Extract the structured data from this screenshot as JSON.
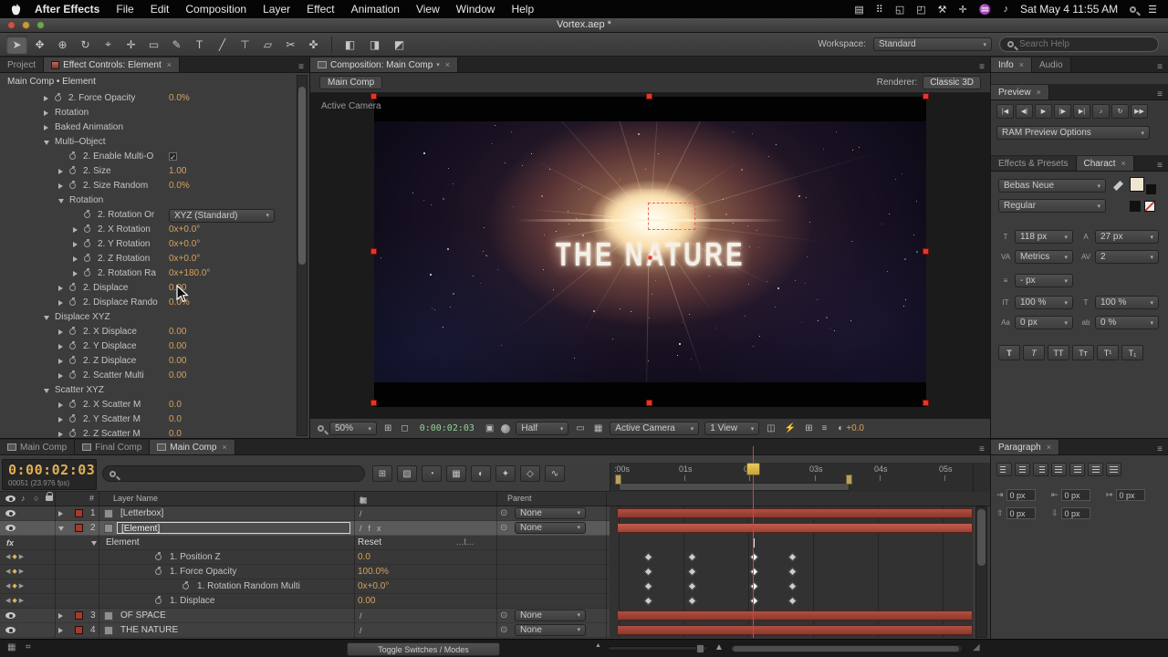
{
  "menubar": {
    "app_name": "After Effects",
    "items": [
      "File",
      "Edit",
      "Composition",
      "Layer",
      "Effect",
      "Animation",
      "View",
      "Window",
      "Help"
    ],
    "status_icons": [
      {
        "name": "display-capture-icon",
        "glyph": "▤"
      },
      {
        "name": "widgets-icon",
        "glyph": "⠿"
      },
      {
        "name": "display-mirror-icon",
        "glyph": "◱"
      },
      {
        "name": "display-icon",
        "glyph": "◰"
      },
      {
        "name": "tool-icon",
        "glyph": "⚒"
      },
      {
        "name": "move-icon",
        "glyph": "✛"
      },
      {
        "name": "wifi-icon",
        "glyph": "♒"
      },
      {
        "name": "volume-icon",
        "glyph": "♪"
      }
    ],
    "clock": "Sat May 4 11:55 AM"
  },
  "window_title": "Vortex.aep *",
  "toolbar": {
    "tools": [
      {
        "name": "selection-tool",
        "glyph": "➤"
      },
      {
        "name": "hand-tool",
        "glyph": "✥"
      },
      {
        "name": "zoom-tool",
        "glyph": "⊕"
      },
      {
        "name": "rotation-tool",
        "glyph": "↻"
      },
      {
        "name": "unified-camera-tool",
        "glyph": "⌖"
      },
      {
        "name": "pan-behind-tool",
        "glyph": "✛"
      },
      {
        "name": "shape-tool",
        "glyph": "▭"
      },
      {
        "name": "pen-tool",
        "glyph": "✎"
      },
      {
        "name": "type-tool",
        "glyph": "T"
      },
      {
        "name": "brush-tool",
        "glyph": "╱"
      },
      {
        "name": "clone-stamp-tool",
        "glyph": "⊤"
      },
      {
        "name": "eraser-tool",
        "glyph": "▱"
      },
      {
        "name": "roto-brush-tool",
        "glyph": "✂"
      },
      {
        "name": "puppet-pin-tool",
        "glyph": "✜"
      }
    ],
    "axis_buttons": [
      {
        "name": "local-axis-mode-button",
        "glyph": "◧"
      },
      {
        "name": "world-axis-mode-button",
        "glyph": "◨"
      },
      {
        "name": "view-axis-mode-button",
        "glyph": "◩"
      }
    ],
    "workspace_label": "Workspace:",
    "workspace_value": "Standard",
    "search_placeholder": "Search Help"
  },
  "effect_controls": {
    "tab_project": "Project",
    "tab_effects": "Effect Controls: Element",
    "breadcrumb": "Main Comp • Element",
    "rows": [
      {
        "indent": 1,
        "twirl": "r",
        "watch": true,
        "label": "2. Force Opacity",
        "value": "0.0%"
      },
      {
        "indent": 1,
        "twirl": "r",
        "label": "Rotation"
      },
      {
        "indent": 1,
        "twirl": "r",
        "label": "Baked Animation"
      },
      {
        "indent": 1,
        "twirl": "d",
        "label": "Multi–Object"
      },
      {
        "indent": 2,
        "watch": true,
        "label": "2. Enable Multi-O",
        "check": true
      },
      {
        "indent": 2,
        "twirl": "r",
        "watch": true,
        "label": "2. Size",
        "value": "1.00"
      },
      {
        "indent": 2,
        "twirl": "r",
        "watch": true,
        "label": "2. Size Random",
        "value": "0.0%"
      },
      {
        "indent": 2,
        "twirl": "d",
        "label": "Rotation"
      },
      {
        "indent": 3,
        "watch": true,
        "label": "2. Rotation Or",
        "menu": "XYZ (Standard)"
      },
      {
        "indent": 3,
        "twirl": "r",
        "watch": true,
        "label": "2. X Rotation",
        "value": "0x+0.0°"
      },
      {
        "indent": 3,
        "twirl": "r",
        "watch": true,
        "label": "2. Y Rotation",
        "value": "0x+0.0°"
      },
      {
        "indent": 3,
        "twirl": "r",
        "watch": true,
        "label": "2. Z Rotation",
        "value": "0x+0.0°"
      },
      {
        "indent": 3,
        "twirl": "r",
        "watch": true,
        "label": "2. Rotation Ra",
        "value": "0x+180.0°"
      },
      {
        "indent": 2,
        "twirl": "r",
        "watch": true,
        "label": "2. Displace",
        "value": "0.00"
      },
      {
        "indent": 2,
        "twirl": "r",
        "watch": true,
        "label": "2. Displace Rando",
        "value": "0.0%"
      },
      {
        "indent": 1,
        "twirl": "d",
        "label": "Displace XYZ"
      },
      {
        "indent": 2,
        "twirl": "r",
        "watch": true,
        "label": "2. X Displace",
        "value": "0.00"
      },
      {
        "indent": 2,
        "twirl": "r",
        "watch": true,
        "label": "2. Y Displace",
        "value": "0.00"
      },
      {
        "indent": 2,
        "twirl": "r",
        "watch": true,
        "label": "2. Z Displace",
        "value": "0.00"
      },
      {
        "indent": 2,
        "twirl": "r",
        "watch": true,
        "label": "2. Scatter Multi",
        "value": "0.00"
      },
      {
        "indent": 1,
        "twirl": "d",
        "label": "Scatter XYZ"
      },
      {
        "indent": 2,
        "twirl": "r",
        "watch": true,
        "label": "2. X Scatter M",
        "value": "0.0"
      },
      {
        "indent": 2,
        "twirl": "r",
        "watch": true,
        "label": "2. Y Scatter M",
        "value": "0.0"
      },
      {
        "indent": 2,
        "twirl": "r",
        "watch": true,
        "label": "2. Z Scatter M",
        "value": "0.0"
      }
    ]
  },
  "composition": {
    "tab": "Composition: Main Comp",
    "crumb": "Main Comp",
    "renderer_label": "Renderer:",
    "renderer_value": "Classic 3D",
    "view_label": "Active Camera",
    "comp_text": "THE NATURE",
    "statusbar": {
      "zoom": "50%",
      "timecode": "0:00:02:03",
      "resolution": "Half",
      "camera": "Active Camera",
      "views": "1 View",
      "exposure": "+0.0"
    }
  },
  "right_panel": {
    "info_tab": "Info",
    "audio_tab": "Audio",
    "preview_tab": "Preview",
    "preview_buttons": [
      {
        "name": "first-frame-button",
        "glyph": "|◀"
      },
      {
        "name": "previous-frame-button",
        "glyph": "◀|"
      },
      {
        "name": "play-button",
        "glyph": "▶"
      },
      {
        "name": "next-frame-button",
        "glyph": "|▶"
      },
      {
        "name": "last-frame-button",
        "glyph": "▶|"
      },
      {
        "name": "audio-toggle-button",
        "glyph": "♪"
      },
      {
        "name": "loop-button",
        "glyph": "↻"
      },
      {
        "name": "ram-preview-button",
        "glyph": "▶▶"
      }
    ],
    "ram_options": "RAM Preview Options",
    "effects_presets_tab": "Effects & Presets",
    "character_tab": "Charact",
    "character": {
      "font": "Bebas Neue",
      "style": "Regular",
      "rows": [
        {
          "left_icon": "T",
          "left": "118 px",
          "left_name": "font-size-field",
          "right_icon": "A",
          "right": "27 px",
          "right_name": "leading-field"
        },
        {
          "left_icon": "VA",
          "left": "Metrics",
          "left_name": "kerning-field",
          "right_icon": "AV",
          "right": "2",
          "right_name": "tracking-field"
        },
        {
          "left_icon": "≡",
          "left": "- px",
          "left_name": "line-spacing-field",
          "right_icon": "",
          "right": null,
          "right_name": ""
        },
        {
          "left_icon": "IT",
          "left": "100 %",
          "left_name": "vertical-scale-field",
          "right_icon": "T",
          "right": "100 %",
          "right_name": "horizontal-scale-field"
        },
        {
          "left_icon": "Aa",
          "left": "0 px",
          "left_name": "baseline-shift-field",
          "right_icon": "ab",
          "right": "0 %",
          "right_name": "tsume-field"
        }
      ],
      "type_buttons": [
        {
          "name": "faux-bold-button",
          "glyph": "T",
          "cls": "b"
        },
        {
          "name": "faux-italic-button",
          "glyph": "T",
          "cls": "i"
        },
        {
          "name": "all-caps-button",
          "glyph": "TT",
          "cls": ""
        },
        {
          "name": "small-caps-button",
          "glyph": "Tᴛ",
          "cls": ""
        },
        {
          "name": "superscript-button",
          "glyph": "T¹",
          "cls": ""
        },
        {
          "name": "subscript-button",
          "glyph": "T₁",
          "cls": ""
        }
      ]
    }
  },
  "paragraph": {
    "tab": "Paragraph",
    "align_buttons": [
      "align-left-button",
      "align-center-button",
      "align-right-button",
      "justify-last-left-button",
      "justify-last-center-button",
      "justify-last-right-button",
      "justify-all-button"
    ],
    "row1_fields": [
      {
        "name": "indent-left-field",
        "icon": "⇥",
        "value": "0 px"
      },
      {
        "name": "indent-right-field",
        "icon": "⇤",
        "value": "0 px"
      },
      {
        "name": "first-line-indent-field",
        "icon": "↦",
        "value": "0 px"
      }
    ],
    "row2_fields": [
      {
        "name": "space-before-field",
        "icon": "⇧",
        "value": "0 px"
      },
      {
        "name": "space-after-field",
        "icon": "⇩",
        "value": "0 px"
      }
    ]
  },
  "timeline": {
    "tabs": [
      {
        "label": "Main Comp",
        "active": false
      },
      {
        "label": "Final Comp",
        "active": false
      },
      {
        "label": "Main Comp",
        "active": true
      }
    ],
    "timecode": "0:00:02:03",
    "frame_info": "00051 (23.976 fps)",
    "toolbar_icons": [
      {
        "name": "comp-mini-flowchart-icon",
        "glyph": "⊞"
      },
      {
        "name": "draft-3d-icon",
        "glyph": "▧"
      },
      {
        "name": "hide-shy-icon",
        "glyph": "◔"
      },
      {
        "name": "frame-blend-icon",
        "glyph": "▦"
      },
      {
        "name": "motion-blur-icon",
        "glyph": "◐"
      },
      {
        "name": "brainstorm-icon",
        "glyph": "✦"
      },
      {
        "name": "auto-keyframe-icon",
        "glyph": "◇"
      },
      {
        "name": "graph-editor-icon",
        "glyph": "∿"
      }
    ],
    "ruler_ticks": [
      ":00s",
      "01s",
      "02s",
      "03s",
      "04s",
      "05s"
    ],
    "columns": {
      "hash": "#",
      "layer_name": "Layer Name",
      "parent": "Parent"
    },
    "switch_header_icons": [
      {
        "name": "shy-icon",
        "glyph": "◔"
      },
      {
        "name": "collapse-icon",
        "glyph": "✳"
      },
      {
        "name": "quality-icon",
        "glyph": "/"
      },
      {
        "name": "fx-icon",
        "glyph": "fx"
      },
      {
        "name": "frame-blend-icon",
        "glyph": "▦"
      },
      {
        "name": "motion-blur-icon",
        "glyph": "◐"
      }
    ],
    "rows": [
      {
        "kind": "layer",
        "num": "1",
        "name": "[Letterbox]",
        "switches": "/",
        "parent": "None",
        "twirl": "r"
      },
      {
        "kind": "layer",
        "num": "2",
        "name": "[Element]",
        "switches": "/fx",
        "parent": "None",
        "twirl": "d",
        "selected": true
      },
      {
        "kind": "effect",
        "name": "Element",
        "reset_label": "Reset",
        "note": "...t..."
      },
      {
        "kind": "prop",
        "name": "1. Position Z",
        "value": "0.0",
        "indent": 0,
        "keys": [
          42,
          90,
          158,
          200
        ]
      },
      {
        "kind": "prop",
        "name": "1. Force Opacity",
        "value": "100.0%",
        "indent": 0,
        "keys": [
          42,
          90,
          158,
          200
        ]
      },
      {
        "kind": "prop",
        "name": "1. Rotation Random Multi",
        "value": "0x+0.0°",
        "indent": 1,
        "keys": [
          42,
          90,
          158,
          200
        ]
      },
      {
        "kind": "prop",
        "name": "1. Displace",
        "value": "0.00",
        "indent": 0,
        "keys": [
          42,
          90,
          158,
          200
        ]
      },
      {
        "kind": "layer",
        "num": "3",
        "name": "OF SPACE",
        "switches": "/",
        "parent": "None",
        "twirl": "r"
      },
      {
        "kind": "layer",
        "num": "4",
        "name": "THE NATURE",
        "switches": "/",
        "parent": "None",
        "twirl": "r"
      }
    ],
    "toggle_button": "Toggle Switches / Modes"
  }
}
